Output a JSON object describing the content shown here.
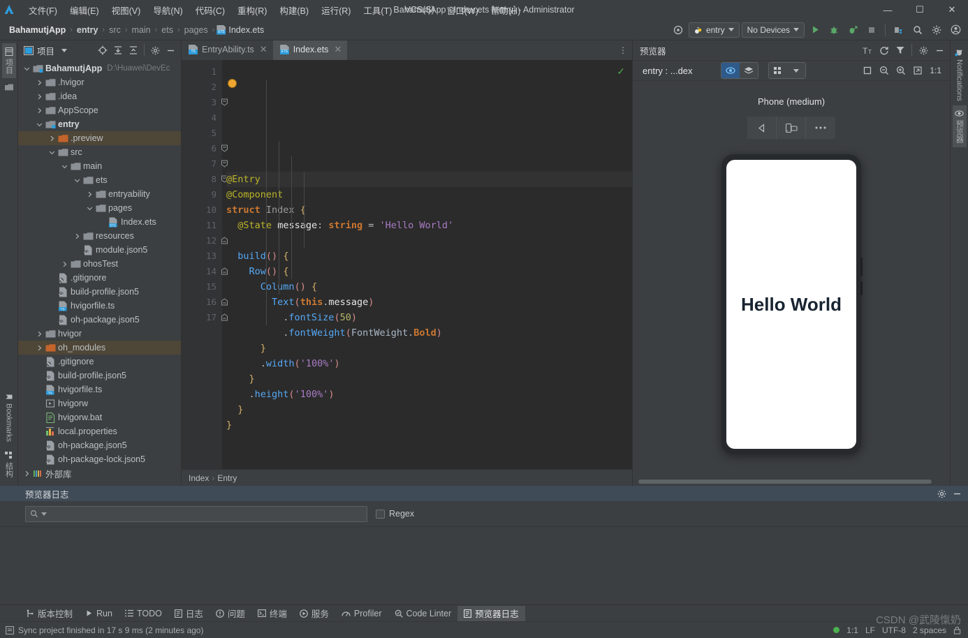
{
  "window": {
    "title": "BahamutjApp - Index.ets [entry] - Administrator",
    "minimize": "—",
    "maximize": "☐",
    "close": "✕"
  },
  "menu": {
    "items": [
      {
        "label": "文件(F)",
        "name": "menu-file"
      },
      {
        "label": "编辑(E)",
        "name": "menu-edit"
      },
      {
        "label": "视图(V)",
        "name": "menu-view"
      },
      {
        "label": "导航(N)",
        "name": "menu-navigate"
      },
      {
        "label": "代码(C)",
        "name": "menu-code"
      },
      {
        "label": "重构(R)",
        "name": "menu-refactor"
      },
      {
        "label": "构建(B)",
        "name": "menu-build"
      },
      {
        "label": "运行(R)",
        "name": "menu-run"
      },
      {
        "label": "工具(T)",
        "name": "menu-tools"
      },
      {
        "label": "VCS(S)",
        "name": "menu-vcs"
      },
      {
        "label": "窗口(W)",
        "name": "menu-window"
      },
      {
        "label": "帮助(H)",
        "name": "menu-help"
      }
    ]
  },
  "breadcrumb": {
    "project": "BahamutjApp",
    "items": [
      "entry",
      "src",
      "main",
      "ets",
      "pages"
    ],
    "file": "Index.ets",
    "separator": "›"
  },
  "run_toolbar": {
    "config_label": "entry",
    "device_label": "No Devices",
    "run_title": "Run",
    "debug_title": "Debug",
    "profile_title": "Profile",
    "stop_title": "Stop",
    "device_manager_title": "Device Manager",
    "search_title": "Search Everywhere",
    "settings_title": "Settings",
    "account_title": "Account"
  },
  "project_panel": {
    "title": "项目",
    "tools": [
      "locate-icon",
      "expand-all-icon",
      "collapse-all-icon",
      "gear-icon",
      "hide-icon"
    ],
    "tree": [
      {
        "depth": 0,
        "label": "BahamutjApp",
        "path": "D:\\Huawei\\DevEc",
        "icon": "module-folder",
        "arrow": "down",
        "bold": true
      },
      {
        "depth": 1,
        "label": ".hvigor",
        "icon": "folder",
        "arrow": "right"
      },
      {
        "depth": 1,
        "label": ".idea",
        "icon": "folder",
        "arrow": "right"
      },
      {
        "depth": 1,
        "label": "AppScope",
        "icon": "folder",
        "arrow": "right"
      },
      {
        "depth": 1,
        "label": "entry",
        "icon": "module-folder",
        "arrow": "down",
        "bold": true
      },
      {
        "depth": 2,
        "label": ".preview",
        "icon": "folder-orange",
        "arrow": "right",
        "highlight": true
      },
      {
        "depth": 2,
        "label": "src",
        "icon": "folder",
        "arrow": "down"
      },
      {
        "depth": 3,
        "label": "main",
        "icon": "folder",
        "arrow": "down"
      },
      {
        "depth": 4,
        "label": "ets",
        "icon": "folder",
        "arrow": "down"
      },
      {
        "depth": 5,
        "label": "entryability",
        "icon": "folder",
        "arrow": "right"
      },
      {
        "depth": 5,
        "label": "pages",
        "icon": "folder",
        "arrow": "down"
      },
      {
        "depth": 6,
        "label": "Index.ets",
        "icon": "file-ets",
        "arrow": "none"
      },
      {
        "depth": 4,
        "label": "resources",
        "icon": "folder",
        "arrow": "right"
      },
      {
        "depth": 4,
        "label": "module.json5",
        "icon": "file-json",
        "arrow": "none"
      },
      {
        "depth": 3,
        "label": "ohosTest",
        "icon": "folder",
        "arrow": "right"
      },
      {
        "depth": 2,
        "label": ".gitignore",
        "icon": "file-git",
        "arrow": "none"
      },
      {
        "depth": 2,
        "label": "build-profile.json5",
        "icon": "file-json",
        "arrow": "none"
      },
      {
        "depth": 2,
        "label": "hvigorfile.ts",
        "icon": "file-ts",
        "arrow": "none"
      },
      {
        "depth": 2,
        "label": "oh-package.json5",
        "icon": "file-json",
        "arrow": "none"
      },
      {
        "depth": 1,
        "label": "hvigor",
        "icon": "folder",
        "arrow": "right"
      },
      {
        "depth": 1,
        "label": "oh_modules",
        "icon": "folder-orange",
        "arrow": "right",
        "highlight": true
      },
      {
        "depth": 1,
        "label": ".gitignore",
        "icon": "file-git",
        "arrow": "none"
      },
      {
        "depth": 1,
        "label": "build-profile.json5",
        "icon": "file-json",
        "arrow": "none"
      },
      {
        "depth": 1,
        "label": "hvigorfile.ts",
        "icon": "file-ts",
        "arrow": "none"
      },
      {
        "depth": 1,
        "label": "hvigorw",
        "icon": "file-exec",
        "arrow": "none"
      },
      {
        "depth": 1,
        "label": "hvigorw.bat",
        "icon": "file-bat",
        "arrow": "none"
      },
      {
        "depth": 1,
        "label": "local.properties",
        "icon": "file-props",
        "arrow": "none"
      },
      {
        "depth": 1,
        "label": "oh-package.json5",
        "icon": "file-json",
        "arrow": "none"
      },
      {
        "depth": 1,
        "label": "oh-package-lock.json5",
        "icon": "file-json",
        "arrow": "none"
      },
      {
        "depth": 0,
        "label": "外部库",
        "icon": "library",
        "arrow": "right"
      }
    ]
  },
  "left_strip": {
    "tabs": [
      {
        "label": "项目",
        "name": "strip-tab-project"
      }
    ],
    "bottom_tabs": [
      {
        "label": "Bookmarks",
        "name": "strip-tab-bookmarks"
      },
      {
        "label": "结构",
        "name": "strip-tab-structure"
      }
    ]
  },
  "right_strip": {
    "tabs": [
      {
        "label": "Notifications",
        "name": "strip-tab-notifications"
      },
      {
        "label": "预览器",
        "name": "strip-tab-previewer"
      }
    ]
  },
  "editor": {
    "tabs": [
      {
        "label": "EntryAbility.ts",
        "active": false,
        "icon": "file-ts",
        "close": "✕"
      },
      {
        "label": "Index.ets",
        "active": true,
        "icon": "file-ets",
        "close": "✕"
      }
    ],
    "options_icon": "⋮",
    "inspection_ok": "✓",
    "line_numbers": [
      "1",
      "2",
      "3",
      "4",
      "5",
      "6",
      "7",
      "8",
      "9",
      "10",
      "11",
      "12",
      "13",
      "14",
      "15",
      "16",
      "17"
    ],
    "breadcrumb": [
      "Index",
      "Entry"
    ],
    "breadcrumb_sep": "›",
    "code_lines": [
      "@Entry",
      "@Component",
      "struct Index {",
      "  @State message: string = 'Hello World'",
      "",
      "  build() {",
      "    Row() {",
      "      Column() {",
      "        Text(this.message)",
      "          .fontSize(50)",
      "          .fontWeight(FontWeight.Bold)",
      "      }",
      "      .width('100%')",
      "    }",
      "    .height('100%')",
      "  }",
      "}"
    ]
  },
  "previewer": {
    "title": "预览器",
    "head_tools": [
      "font-size-icon",
      "refresh-icon",
      "filter-icon",
      "gear-icon",
      "hide-icon"
    ],
    "target": "entry : ...dex",
    "inspector_icon": "eye-inspect-icon",
    "layers_icon": "layers-icon",
    "grid_icon": "grid-icon",
    "dropdown_icon": "chevron-down-icon",
    "fit_icon": "fit-icon",
    "zoom_out_icon": "zoom-out-icon",
    "zoom_in_icon": "zoom-in-icon",
    "expand_icon": "expand-icon",
    "ratio": "1:1",
    "device_name": "Phone (medium)",
    "device_controls": [
      "back-icon",
      "rotate-icon",
      "more-icon"
    ],
    "screen_text": "Hello World"
  },
  "log_panel": {
    "title": "预览器日志",
    "search_value": "",
    "search_placeholder": "",
    "search_icon": "search-icon",
    "regex_label": "Regex",
    "regex_checked": false,
    "gear_icon": "gear-icon",
    "hide_icon": "hide-icon"
  },
  "toolwindow_bar": {
    "items": [
      {
        "label": "版本控制",
        "icon": "vcs-icon",
        "selected": false
      },
      {
        "label": "Run",
        "icon": "run-icon",
        "selected": false
      },
      {
        "label": "TODO",
        "icon": "todo-icon",
        "selected": false
      },
      {
        "label": "日志",
        "icon": "log-icon",
        "selected": false
      },
      {
        "label": "问题",
        "icon": "problems-icon",
        "selected": false
      },
      {
        "label": "终端",
        "icon": "terminal-icon",
        "selected": false
      },
      {
        "label": "服务",
        "icon": "services-icon",
        "selected": false
      },
      {
        "label": "Profiler",
        "icon": "profiler-icon",
        "selected": false
      },
      {
        "label": "Code Linter",
        "icon": "linter-icon",
        "selected": false
      },
      {
        "label": "预览器日志",
        "icon": "previewer-log-icon",
        "selected": true
      }
    ]
  },
  "statusbar": {
    "message": "Sync project finished in 17 s 9 ms (2 minutes ago)",
    "message_icon": "event-log-icon",
    "caret": "1:1",
    "line_sep": "LF",
    "encoding": "UTF-8",
    "indent": "2 spaces",
    "lock_icon": "lock-icon"
  },
  "watermark": "CSDN @武陵愾奶",
  "colors": {
    "accent": "#2d9cdb",
    "bg_panel": "#3c3f41",
    "bg_editor": "#2b2b2b",
    "ok_green": "#4caf50",
    "highlight": "#4e4637"
  }
}
